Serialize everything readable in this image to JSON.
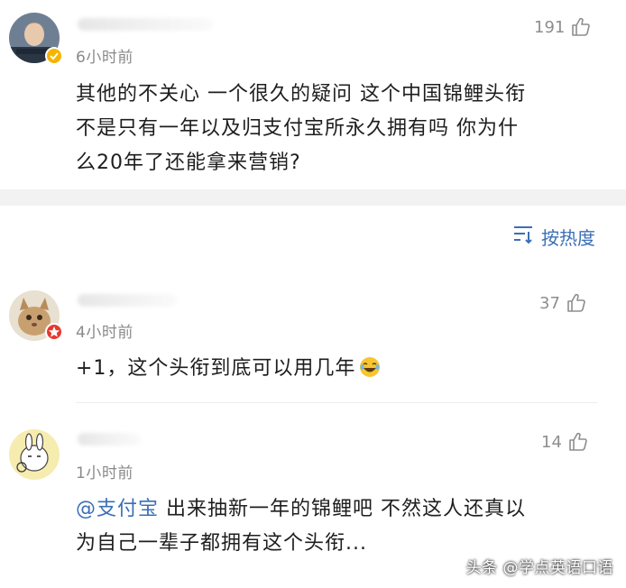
{
  "comments": [
    {
      "time": "6小时前",
      "likes": "191",
      "lines": [
        "其他的不关心 一个很久的疑问 这个中国锦鲤头衔",
        "不是只有一年以及归支付宝所永久拥有吗 你为什",
        "么20年了还能拿来营销?"
      ]
    },
    {
      "time": "4小时前",
      "likes": "37",
      "text": "+1，这个头衔到底可以用几年"
    },
    {
      "time": "1小时前",
      "likes": "14",
      "mention": "@支付宝",
      "line1_rest": " 出来抽新一年的锦鲤吧 不然这人还真以",
      "line2": "为自己一辈子都拥有这个头衔..."
    }
  ],
  "sort": {
    "label": "按热度",
    "icon": "sort-icon"
  },
  "watermark": "头条 @学点英语口语",
  "colors": {
    "link": "#3b6fb5",
    "muted": "#8a8a8a",
    "divider": "#f2f2f2"
  }
}
